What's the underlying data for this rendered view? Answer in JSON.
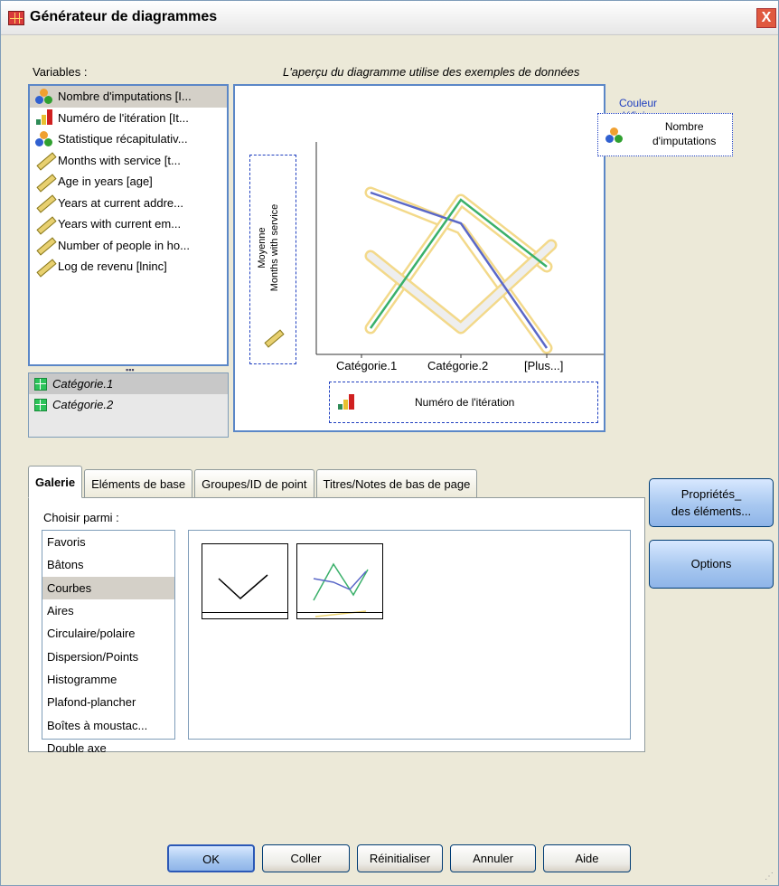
{
  "window": {
    "title": "Générateur de diagrammes",
    "close_label": "X"
  },
  "variables_label": "Variables :",
  "preview_note": "L'aperçu du diagramme utilise des exemples de données",
  "variables": [
    {
      "label": "Nombre d'imputations [I...",
      "type": "nominal"
    },
    {
      "label": "Numéro de l'itération [It...",
      "type": "ordinal"
    },
    {
      "label": "Statistique récapitulativ...",
      "type": "nominal"
    },
    {
      "label": "Months with service [t...",
      "type": "scale"
    },
    {
      "label": "Age in years [age]",
      "type": "scale"
    },
    {
      "label": "Years at current addre...",
      "type": "scale"
    },
    {
      "label": "Years with current em...",
      "type": "scale"
    },
    {
      "label": "Number of people in ho...",
      "type": "scale"
    },
    {
      "label": "Log de revenu [lninc]",
      "type": "scale"
    }
  ],
  "categories": [
    "Catégorie.1",
    "Catégorie.2"
  ],
  "canvas": {
    "legend_title": "Couleur définie",
    "legend_value_line1": "Nombre",
    "legend_value_line2": "d'imputations",
    "y_drop_line1": "Moyenne",
    "y_drop_line2": "Months with service",
    "x_ticks": [
      "Catégorie.1",
      "Catégorie.2",
      "[Plus...]"
    ],
    "x_drop_label": "Numéro de l'itération",
    "colors": {
      "line_blue": "#5a68c8",
      "line_green": "#3ab06a",
      "line_gold": "#f3d98a",
      "line_gray": "#d8d8d8"
    }
  },
  "tabs": [
    "Galerie",
    "Eléments de base",
    "Groupes/ID de point",
    "Titres/Notes de bas de page"
  ],
  "choose_label": "Choisir parmi :",
  "chart_types": [
    "Favoris",
    "Bâtons",
    "Courbes",
    "Aires",
    "Circulaire/polaire",
    "Dispersion/Points",
    "Histogramme",
    "Plafond-plancher",
    "Boîtes à moustac...",
    "Double axe"
  ],
  "selected_type": "Courbes",
  "side_buttons": {
    "properties_line1": "Propriétés_",
    "properties_line2": "des éléments...",
    "options": "Options"
  },
  "buttons": {
    "ok": "OK",
    "paste": "Coller",
    "reset": "Réinitialiser",
    "cancel": "Annuler",
    "help": "Aide"
  }
}
